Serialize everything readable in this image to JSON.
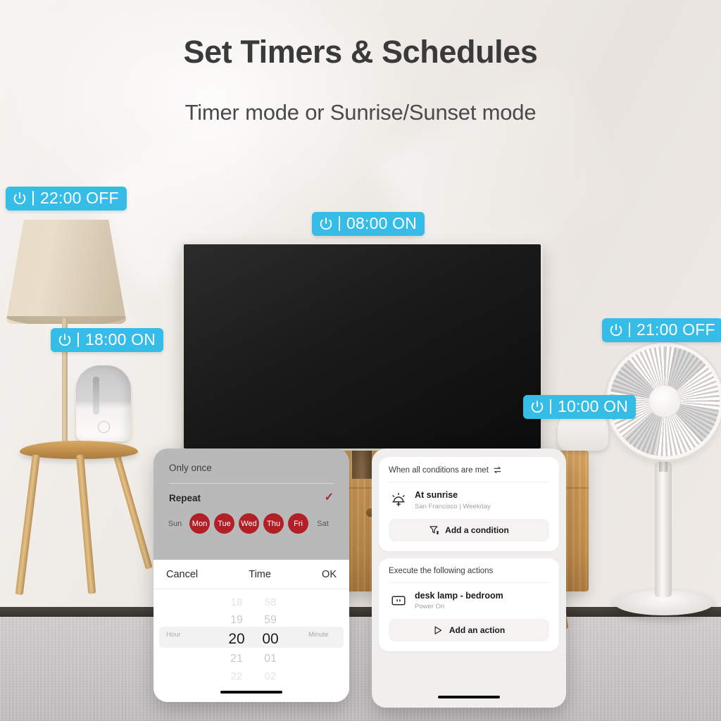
{
  "headline": "Set Timers & Schedules",
  "subhead": "Timer mode or Sunrise/Sunset mode",
  "accent_color": "#35bde8",
  "selected_day_color": "#b21f26",
  "badges": [
    {
      "id": "badge-2200",
      "icon": "power-icon",
      "time": "22:00",
      "state": "OFF",
      "label": "22:00 OFF"
    },
    {
      "id": "badge-0800",
      "icon": "power-icon",
      "time": "08:00",
      "state": "ON",
      "label": "08:00 ON"
    },
    {
      "id": "badge-1800",
      "icon": "power-icon",
      "time": "18:00",
      "state": "ON",
      "label": "18:00 ON"
    },
    {
      "id": "badge-2100",
      "icon": "power-icon",
      "time": "21:00",
      "state": "OFF",
      "label": "21:00 OFF"
    },
    {
      "id": "badge-1000",
      "icon": "power-icon",
      "time": "10:00",
      "state": "ON",
      "label": "10:00 ON"
    }
  ],
  "timer_phone": {
    "repeat_sheet": {
      "only_once_label": "Only once",
      "repeat_label": "Repeat",
      "check_glyph": "✓",
      "days": [
        {
          "label": "Sun",
          "selected": false
        },
        {
          "label": "Mon",
          "selected": true
        },
        {
          "label": "Tue",
          "selected": true
        },
        {
          "label": "Wed",
          "selected": true
        },
        {
          "label": "Thu",
          "selected": true
        },
        {
          "label": "Fri",
          "selected": true
        },
        {
          "label": "Sat",
          "selected": false
        }
      ]
    },
    "picker": {
      "cancel_label": "Cancel",
      "title": "Time",
      "ok_label": "OK",
      "hour_label": "Hour",
      "minute_label": "Minute",
      "hours": [
        "18",
        "19",
        "20",
        "21",
        "22"
      ],
      "minutes": [
        "58",
        "59",
        "00",
        "01",
        "02"
      ],
      "selected_hour": "20",
      "selected_minute": "00"
    }
  },
  "automation_phone": {
    "conditions": {
      "header": "When all conditions are met",
      "header_icon": "swap-arrows-icon",
      "item": {
        "icon": "sunrise-icon",
        "title": "At sunrise",
        "subtitle": "San Francisco | Weekday"
      },
      "add_button": {
        "icon": "filter-add-icon",
        "label": "Add a condition"
      }
    },
    "actions": {
      "header": "Execute the following actions",
      "item": {
        "icon": "smart-plug-icon",
        "title": "desk lamp - bedroom",
        "subtitle": "Power On"
      },
      "add_button": {
        "icon": "play-add-icon",
        "label": "Add an action"
      }
    }
  }
}
